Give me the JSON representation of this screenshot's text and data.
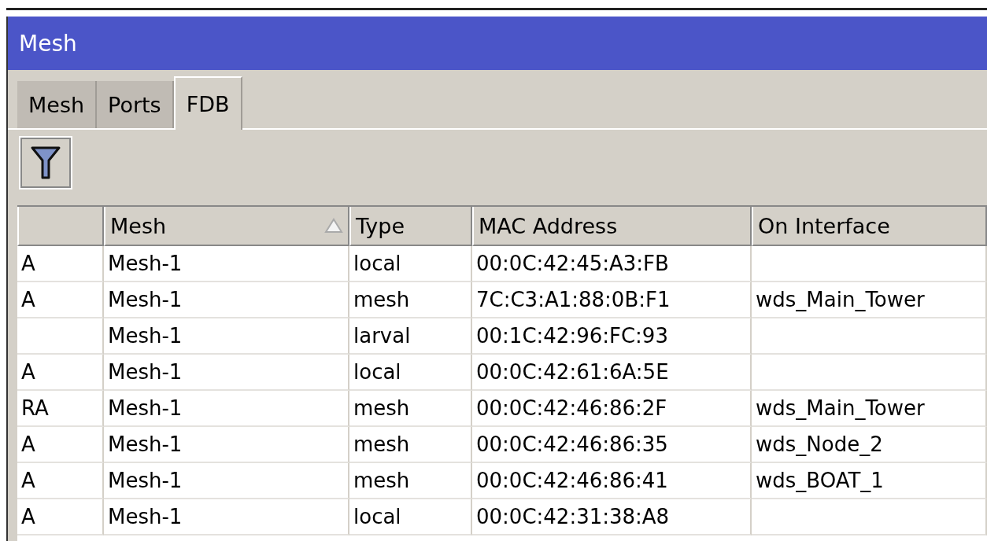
{
  "window": {
    "title": "Mesh"
  },
  "tabs": [
    {
      "label": "Mesh",
      "selected": false
    },
    {
      "label": "Ports",
      "selected": false
    },
    {
      "label": "FDB",
      "selected": true
    }
  ],
  "table": {
    "columns": [
      {},
      {
        "label": "Mesh",
        "sorted": true
      },
      {
        "label": "Type"
      },
      {
        "label": "MAC Address"
      },
      {
        "label": "On Interface"
      }
    ],
    "rows": [
      {
        "flags": "A",
        "mesh": "Mesh-1",
        "type": "local",
        "mac_address": "00:0C:42:45:A3:FB"
      },
      {
        "flags": "A",
        "mesh": "Mesh-1",
        "type": "mesh",
        "mac_address": "7C:C3:A1:88:0B:F1",
        "on_interface": "wds_Main_Tower"
      },
      {
        "mesh": "Mesh-1",
        "type": "larval",
        "mac_address": "00:1C:42:96:FC:93"
      },
      {
        "flags": "A",
        "mesh": "Mesh-1",
        "type": "local",
        "mac_address": "00:0C:42:61:6A:5E"
      },
      {
        "flags": "RA",
        "mesh": "Mesh-1",
        "type": "mesh",
        "mac_address": "00:0C:42:46:86:2F",
        "on_interface": "wds_Main_Tower"
      },
      {
        "flags": "A",
        "mesh": "Mesh-1",
        "type": "mesh",
        "mac_address": "00:0C:42:46:86:35",
        "on_interface": "wds_Node_2"
      },
      {
        "flags": "A",
        "mesh": "Mesh-1",
        "type": "mesh",
        "mac_address": "00:0C:42:46:86:41",
        "on_interface": "wds_BOAT_1"
      },
      {
        "flags": "A",
        "mesh": "Mesh-1",
        "type": "local",
        "mac_address": "00:0C:42:31:38:A8"
      }
    ]
  }
}
